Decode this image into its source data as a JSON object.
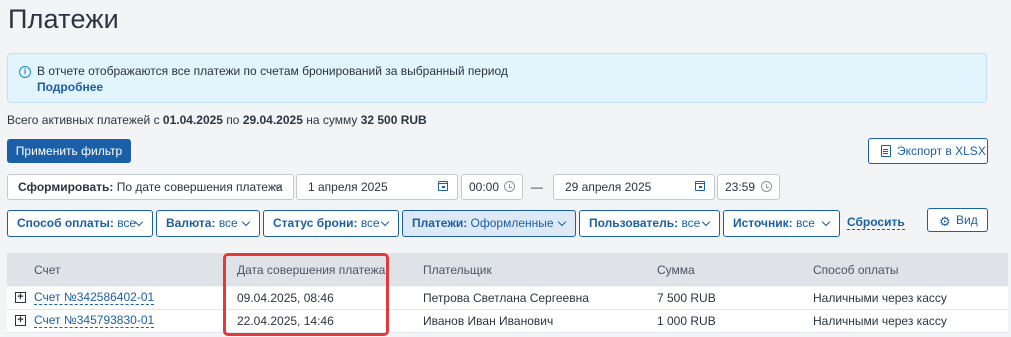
{
  "page_title": "Платежи",
  "info": {
    "text": "В отчете отображаются все платежи по счетам бронирований за выбранный период",
    "link": "Подробнее"
  },
  "summary": {
    "prefix": "Всего активных платежей с ",
    "from": "01.04.2025",
    "mid": " по ",
    "to": "29.04.2025",
    "mid2": " на сумму ",
    "amount": "32 500 RUB"
  },
  "toolbar": {
    "apply_filter": "Применить фильтр",
    "export": "Экспорт в XLSX"
  },
  "period": {
    "form_label": "Сформировать:",
    "form_value": "По дате совершения платежа",
    "date_from": "1 апреля 2025",
    "time_from": "00:00",
    "dash": "—",
    "date_to": "29 апреля 2025",
    "time_to": "23:59"
  },
  "filters": [
    {
      "label": "Способ оплаты:",
      "value": "все"
    },
    {
      "label": "Валюта:",
      "value": "все"
    },
    {
      "label": "Статус брони:",
      "value": "все"
    },
    {
      "label": "Платежи:",
      "value": "Оформленные"
    },
    {
      "label": "Пользователь:",
      "value": "все"
    },
    {
      "label": "Источник:",
      "value": "все"
    }
  ],
  "reset": "Сбросить",
  "view": "Вид",
  "table": {
    "columns": [
      "Счет",
      "Дата совершения платежа",
      "Плательщик",
      "Сумма",
      "Способ оплаты"
    ],
    "rows": [
      [
        "Счет №342586402-01",
        "09.04.2025, 08:46",
        "Петрова Светлана Сергеевна",
        "7 500 RUB",
        "Наличными через кассу"
      ],
      [
        "Счет №345793830-01",
        "22.04.2025, 14:46",
        "Иванов Иван Иванович",
        "1 000 RUB",
        "Наличными через кассу"
      ]
    ]
  }
}
